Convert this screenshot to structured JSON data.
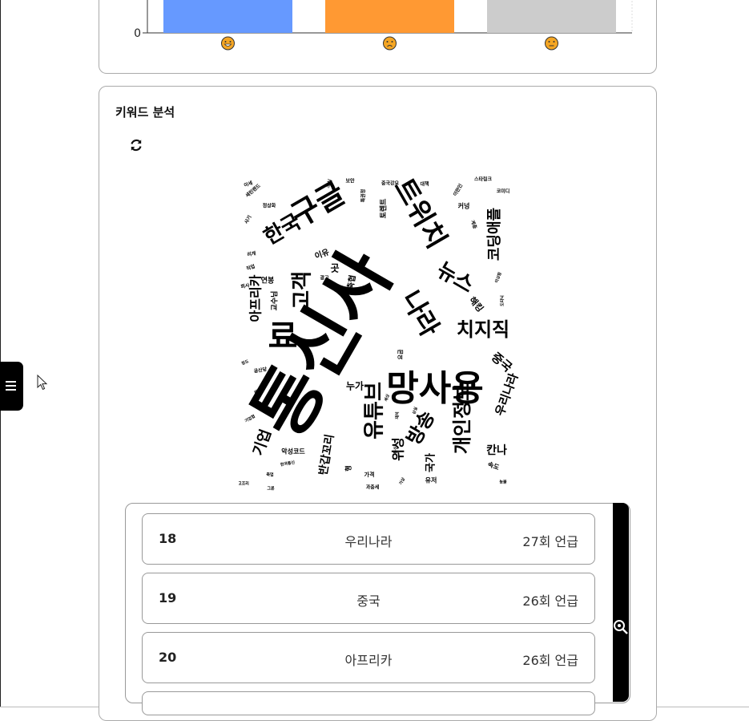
{
  "sentiment_chart": {
    "y_tick_zero": "0",
    "bars": [
      {
        "color": "#6699ff",
        "face": "grinning-face",
        "face_color": "#f5a623"
      },
      {
        "color": "#ff9933",
        "face": "tired-face",
        "face_color": "#f5a623"
      },
      {
        "color": "#cccccc",
        "face": "neutral-face",
        "face_color": "#f5a623"
      }
    ]
  },
  "keyword_section": {
    "title": "키워드 분석",
    "refresh_icon": "refresh-icon"
  },
  "wordcloud": [
    {
      "t": "통신사",
      "s": 90
    },
    {
      "t": "망사용",
      "s": 44
    },
    {
      "t": "구글",
      "s": 38
    },
    {
      "t": "료",
      "s": 40
    },
    {
      "t": "트위치",
      "s": 34
    },
    {
      "t": "나라",
      "s": 32
    },
    {
      "t": "한국",
      "s": 26
    },
    {
      "t": "고객",
      "s": 26
    },
    {
      "t": "유튜브",
      "s": 26
    },
    {
      "t": "치지직",
      "s": 24
    },
    {
      "t": "뉴스",
      "s": 26
    },
    {
      "t": "개인정보",
      "s": 24
    },
    {
      "t": "방송",
      "s": 24
    },
    {
      "t": "코딩애플",
      "s": 18
    },
    {
      "t": "아프리카",
      "s": 16
    },
    {
      "t": "기업",
      "s": 18
    },
    {
      "t": "반갑꼬리",
      "s": 14
    },
    {
      "t": "우리나라",
      "s": 15
    },
    {
      "t": "위성",
      "s": 16
    },
    {
      "t": "중국",
      "s": 15
    },
    {
      "t": "칸나",
      "s": 14
    },
    {
      "t": "국가",
      "s": 13
    },
    {
      "t": "누가",
      "s": 12
    },
    {
      "t": "해킹",
      "s": 11
    },
    {
      "t": "곳",
      "s": 12
    },
    {
      "t": "이유",
      "s": 10
    },
    {
      "t": "축협",
      "s": 10
    },
    {
      "t": "교수님",
      "s": 9
    },
    {
      "t": "연봉",
      "s": 9
    },
    {
      "t": "토렌트",
      "s": 9
    },
    {
      "t": "커넝",
      "s": 8
    },
    {
      "t": "악성코드",
      "s": 8
    },
    {
      "t": "속도",
      "s": 8
    },
    {
      "t": "유저",
      "s": 8
    },
    {
      "t": "가격",
      "s": 7
    },
    {
      "t": "과충세",
      "s": 6
    },
    {
      "t": "행",
      "s": 8
    },
    {
      "t": "요금",
      "s": 7
    },
    {
      "t": "소식",
      "s": 6
    },
    {
      "t": "보안",
      "s": 6
    },
    {
      "t": "스타링크",
      "s": 6
    },
    {
      "t": "코미디",
      "s": 6
    },
    {
      "t": "중국강요",
      "s": 6
    },
    {
      "t": "대책",
      "s": 6
    },
    {
      "t": "이란인",
      "s": 6
    },
    {
      "t": "계층",
      "s": 6
    },
    {
      "t": "세린랜드",
      "s": 6
    },
    {
      "t": "정상화",
      "s": 6
    },
    {
      "t": "이세",
      "s": 6
    },
    {
      "t": "특권정",
      "s": 6
    },
    {
      "t": "도파닉",
      "s": 5
    },
    {
      "t": "이상함",
      "s": 5
    },
    {
      "t": "공산당",
      "s": 6
    },
    {
      "t": "사기",
      "s": 6
    },
    {
      "t": "리게",
      "s": 6
    },
    {
      "t": "직업",
      "s": 6
    },
    {
      "t": "회사",
      "s": 6
    },
    {
      "t": "광고",
      "s": 6
    },
    {
      "t": "정도",
      "s": 5
    },
    {
      "t": "배우",
      "s": 5
    },
    {
      "t": "목적",
      "s": 5
    },
    {
      "t": "기업협",
      "s": 5
    },
    {
      "t": "고조리",
      "s": 5
    },
    {
      "t": "그론",
      "s": 5
    },
    {
      "t": "한국통신",
      "s": 5
    },
    {
      "t": "축업",
      "s": 5
    },
    {
      "t": "농불",
      "s": 5
    },
    {
      "t": "가상",
      "s": 5
    },
    {
      "t": "상실",
      "s": 5
    },
    {
      "t": "재석",
      "s": 5
    },
    {
      "t": "통신",
      "s": 5
    },
    {
      "t": "세상",
      "s": 5
    }
  ],
  "keyword_list": [
    {
      "rank": "18",
      "word": "우리나라",
      "count": "27회 언급"
    },
    {
      "rank": "19",
      "word": "중국",
      "count": "26회 언급"
    },
    {
      "rank": "20",
      "word": "아프리카",
      "count": "26회 언급"
    }
  ]
}
